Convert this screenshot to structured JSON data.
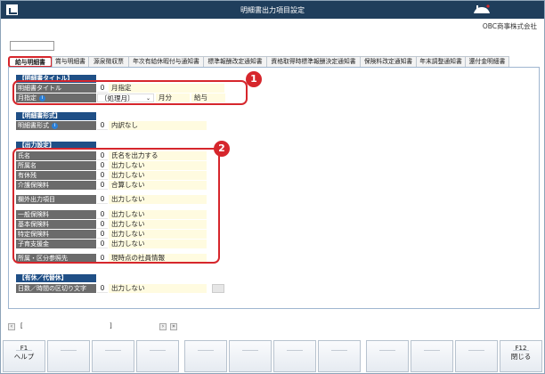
{
  "window": {
    "title": "明細書出力項目設定"
  },
  "company": "OBC商事株式会社",
  "tabs": [
    {
      "label": "給与明細書",
      "active": true
    },
    {
      "label": "賞与明細書"
    },
    {
      "label": "源泉徴収票"
    },
    {
      "label": "年次有給休暇付与通知書"
    },
    {
      "label": "標準報酬改定通知書"
    },
    {
      "label": "資格取得時標準報酬決定通知書"
    },
    {
      "label": "保険料改定通知書"
    },
    {
      "label": "年末調整通知書"
    },
    {
      "label": "還付金明細書"
    }
  ],
  "sections": {
    "title_section": {
      "header": "【明細書タイトル】",
      "row1": {
        "label": "明細書タイトル",
        "code": "0",
        "value": "月指定"
      },
      "row2": {
        "label": "月指定",
        "info": "i",
        "value1": "〔処理月〕",
        "value2": "月分",
        "value3": "給与"
      }
    },
    "format_section": {
      "header": "【明細書形式】",
      "row1": {
        "label": "明細書形式",
        "info": "i",
        "code": "0",
        "value": "内訳なし"
      }
    },
    "output_section": {
      "header": "【出力設定】",
      "rows": [
        {
          "label": "氏名",
          "code": "0",
          "value": "氏名を出力する"
        },
        {
          "label": "所属名",
          "code": "0",
          "value": "出力しない"
        },
        {
          "label": "有休残",
          "code": "0",
          "value": "出力しない"
        },
        {
          "label": "介護保険料",
          "code": "0",
          "value": "合算しない"
        },
        {
          "label": "欄外出力項目",
          "code": "0",
          "value": "出力しない"
        },
        {
          "label": "一般保険料",
          "code": "0",
          "value": "出力しない"
        },
        {
          "label": "基本保険料",
          "code": "0",
          "value": "出力しない"
        },
        {
          "label": "特定保険料",
          "code": "0",
          "value": "出力しない"
        },
        {
          "label": "子育支援金",
          "code": "0",
          "value": "出力しない"
        },
        {
          "label": "所属・区分参照先",
          "code": "0",
          "value": "現時点の社員情報"
        }
      ]
    },
    "leave_section": {
      "header": "【有休／代替休】",
      "row1": {
        "label": "日数／時間の区切り文字",
        "code": "0",
        "value": "出力しない"
      }
    }
  },
  "callouts": {
    "one": "1",
    "two": "2"
  },
  "scroll": {
    "left_bracket": "[",
    "right_bracket": "]"
  },
  "fkeys": [
    {
      "key": "F1",
      "label": "ヘルプ"
    },
    {
      "key": "",
      "label": ""
    },
    {
      "key": "",
      "label": ""
    },
    {
      "key": "",
      "label": ""
    },
    {
      "key": "",
      "label": ""
    },
    {
      "key": "",
      "label": ""
    },
    {
      "key": "",
      "label": ""
    },
    {
      "key": "",
      "label": ""
    },
    {
      "key": "",
      "label": ""
    },
    {
      "key": "",
      "label": ""
    },
    {
      "key": "",
      "label": ""
    },
    {
      "key": "F12",
      "label": "閉じる"
    }
  ],
  "colors": {
    "titlebar": "#1f3e5c",
    "section_header": "#1f4f86",
    "label_bg": "#6b6b6b",
    "value_bg": "#fffbe0",
    "callout": "#d6262c"
  }
}
